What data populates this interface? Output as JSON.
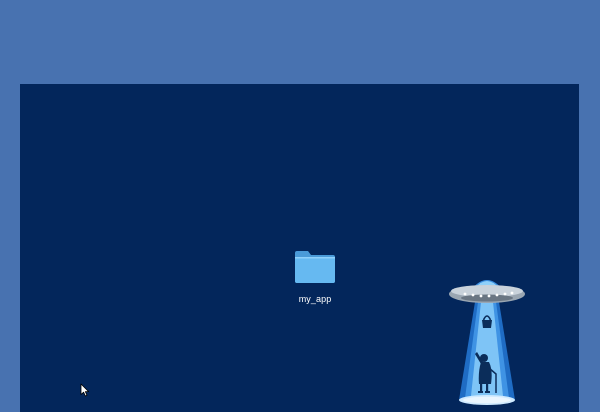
{
  "desktop": {
    "background_color": "#4872b0",
    "window_color": "#03265b",
    "items": [
      {
        "label": "my_app",
        "icon": "folder-icon",
        "color": "#5fb4ee"
      }
    ],
    "decoration": {
      "icon": "ufo-abduction-icon"
    },
    "pointer": {
      "icon": "arrow-cursor-icon"
    }
  }
}
